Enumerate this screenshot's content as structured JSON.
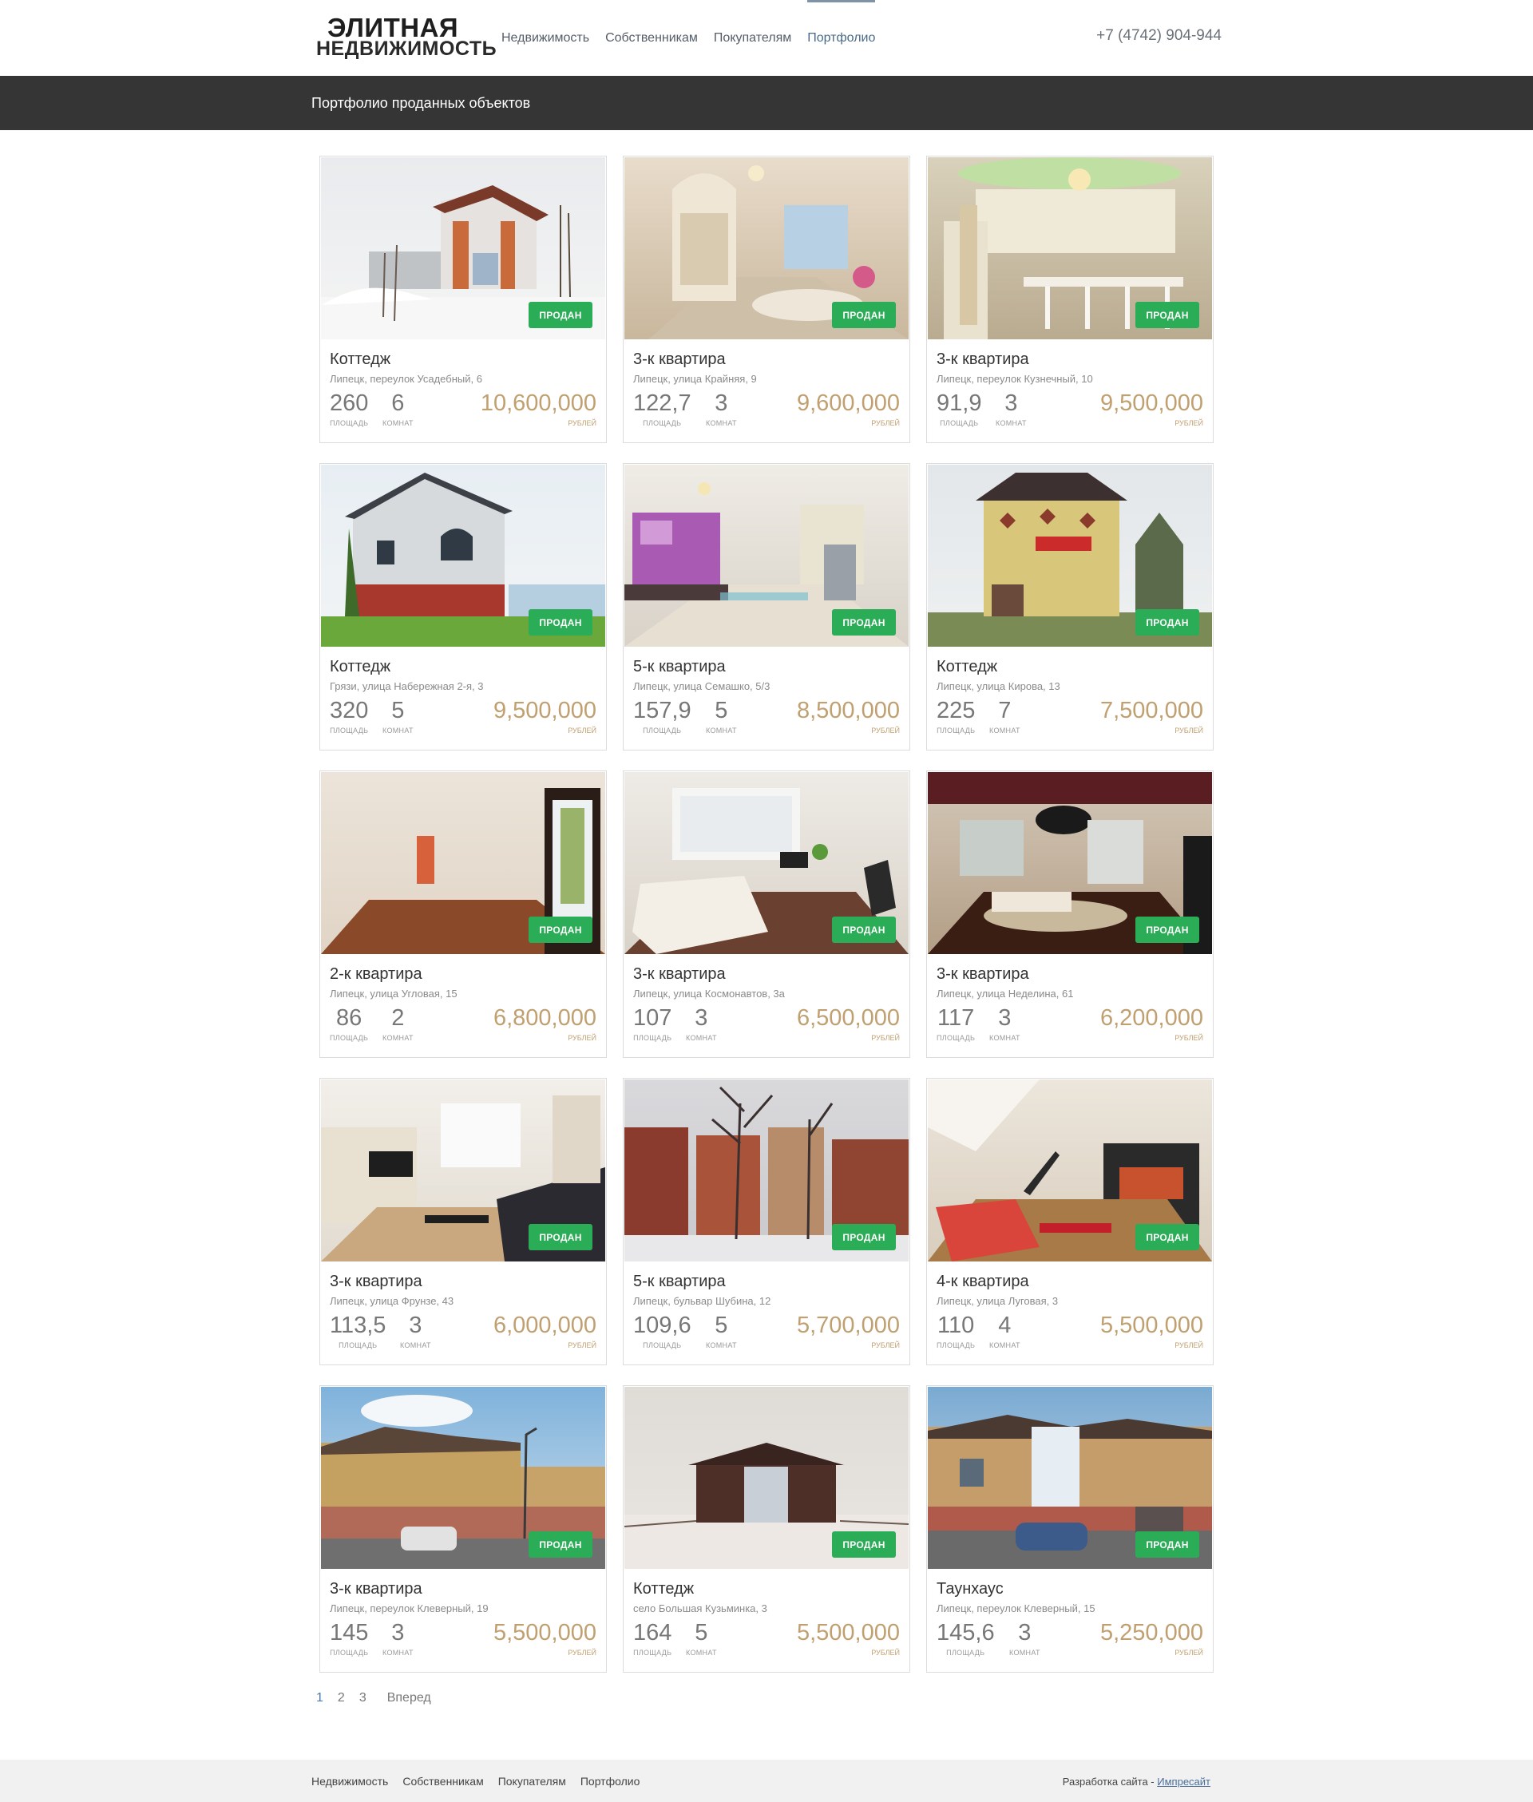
{
  "header": {
    "logo_line1": "ЭЛИТНАЯ",
    "logo_line2": "НЕДВИЖИМОСТЬ",
    "nav": [
      "Недвижимость",
      "Собственникам",
      "Покупателям",
      "Портфолио"
    ],
    "active_nav": "Портфолио",
    "phone": "+7 (4742) 904-944"
  },
  "page_title": "Портфолио проданных объектов",
  "labels": {
    "sold": "ПРОДАН",
    "area": "ПЛОЩАДЬ",
    "rooms": "КОМНАТ",
    "currency": "РУБЛЕЙ"
  },
  "listings": [
    {
      "title": "Коттедж",
      "address": "Липецк, переулок Усадебный, 6",
      "area": "260",
      "rooms": "6",
      "price": "10,600,000",
      "scene": "house-winter"
    },
    {
      "title": "3-к квартира",
      "address": "Липецк, улица Крайняя, 9",
      "area": "122,7",
      "rooms": "3",
      "price": "9,600,000",
      "scene": "kitchen-beige"
    },
    {
      "title": "3-к квартира",
      "address": "Липецк, переулок Кузнечный, 10",
      "area": "91,9",
      "rooms": "3",
      "price": "9,500,000",
      "scene": "kitchen-white"
    },
    {
      "title": "Коттедж",
      "address": "Грязи, улица Набережная 2-я, 3",
      "area": "320",
      "rooms": "5",
      "price": "9,500,000",
      "scene": "house-summer"
    },
    {
      "title": "5-к квартира",
      "address": "Липецк, улица Семашко, 5/3",
      "area": "157,9",
      "rooms": "5",
      "price": "8,500,000",
      "scene": "kitchen-purple"
    },
    {
      "title": "Коттедж",
      "address": "Липецк, улица Кирова, 13",
      "area": "225",
      "rooms": "7",
      "price": "7,500,000",
      "scene": "house-yellow"
    },
    {
      "title": "2-к квартира",
      "address": "Липецк, улица Угловая, 15",
      "area": "86",
      "rooms": "2",
      "price": "6,800,000",
      "scene": "room-empty"
    },
    {
      "title": "3-к квартира",
      "address": "Липецк, улица Космонавтов, 3а",
      "area": "107",
      "rooms": "3",
      "price": "6,500,000",
      "scene": "room-sofa"
    },
    {
      "title": "3-к квартира",
      "address": "Липецк, улица Неделина, 61",
      "area": "117",
      "rooms": "3",
      "price": "6,200,000",
      "scene": "room-dark"
    },
    {
      "title": "3-к квартира",
      "address": "Липецк, улица Фрунзе, 43",
      "area": "113,5",
      "rooms": "3",
      "price": "6,000,000",
      "scene": "room-tv"
    },
    {
      "title": "5-к квартира",
      "address": "Липецк, бульвар Шубина, 12",
      "area": "109,6",
      "rooms": "5",
      "price": "5,700,000",
      "scene": "building-winter"
    },
    {
      "title": "4-к квартира",
      "address": "Липецк, улица Луговая, 3",
      "area": "110",
      "rooms": "4",
      "price": "5,500,000",
      "scene": "room-red"
    },
    {
      "title": "3-к квартира",
      "address": "Липецк, переулок Клеверный, 19",
      "area": "145",
      "rooms": "3",
      "price": "5,500,000",
      "scene": "townhouse-sky"
    },
    {
      "title": "Коттедж",
      "address": "село Большая Кузьминка, 3",
      "area": "164",
      "rooms": "5",
      "price": "5,500,000",
      "scene": "cottage-snow"
    },
    {
      "title": "Таунхаус",
      "address": "Липецк, переулок Клеверный, 15",
      "area": "145,6",
      "rooms": "3",
      "price": "5,250,000",
      "scene": "townhouse-car"
    }
  ],
  "pagination": {
    "pages": [
      "1",
      "2",
      "3"
    ],
    "current": "1",
    "next": "Вперед"
  },
  "footer": {
    "nav": [
      "Недвижимость",
      "Собственникам",
      "Покупателям",
      "Портфолио"
    ],
    "credit_text": "Разработка сайта - ",
    "credit_link": "Импресайт"
  },
  "colors": {
    "sold_badge": "#2bac56",
    "price": "#c0a070",
    "titlebar": "#353535",
    "footer": "#f1f1f1"
  }
}
